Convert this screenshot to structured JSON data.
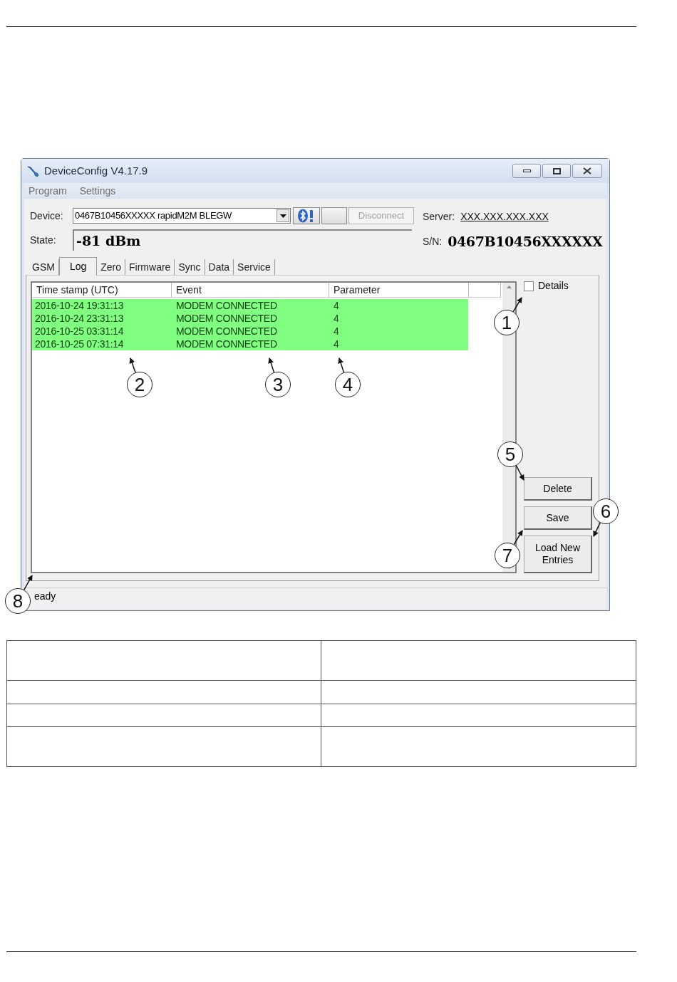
{
  "window": {
    "title": "DeviceConfig V4.17.9"
  },
  "menu": [
    {
      "label": "Program"
    },
    {
      "label": "Settings"
    }
  ],
  "device": {
    "label": "Device:",
    "value": "0467B10456XXXXX rapidM2M BLEGW"
  },
  "connect_buttons": [
    {
      "kind": "bluetooth"
    },
    {
      "kind": "blank"
    },
    {
      "kind": "text",
      "label": "Disconnect",
      "disabled": true
    }
  ],
  "server": {
    "label": "Server:",
    "value": "XXX.XXX.XXX.XXX"
  },
  "state": {
    "label": "State:",
    "value": "-81 dBm"
  },
  "serial": {
    "label": "S/N:",
    "value": "0467B10456XXXXXX"
  },
  "tabs": [
    {
      "label": "GSM",
      "selected": false
    },
    {
      "label": "Log",
      "selected": true
    },
    {
      "label": "Zero",
      "selected": false
    },
    {
      "label": "Firmware",
      "selected": false
    },
    {
      "label": "Sync",
      "selected": false
    },
    {
      "label": "Data",
      "selected": false
    },
    {
      "label": "Service",
      "selected": false
    }
  ],
  "table": {
    "columns": [
      "Time stamp (UTC)",
      "Event",
      "Parameter"
    ],
    "rows": [
      {
        "cells": [
          "2016-10-24 19:31:13",
          "MODEM CONNECTED",
          "4"
        ],
        "color": "#80ff80"
      },
      {
        "cells": [
          "2016-10-24 23:31:13",
          "MODEM CONNECTED",
          "4"
        ],
        "color": "#80ff80"
      },
      {
        "cells": [
          "2016-10-25 03:31:14",
          "MODEM CONNECTED",
          "4"
        ],
        "color": "#80ff80"
      },
      {
        "cells": [
          "2016-10-25 07:31:14",
          "MODEM CONNECTED",
          "4"
        ],
        "color": "#80ff80"
      }
    ]
  },
  "details": {
    "label": "Details",
    "checked": false
  },
  "buttons": [
    {
      "label": "Delete"
    },
    {
      "label": "Save"
    },
    {
      "label": "Load New Entries"
    }
  ],
  "status_bar": "eady",
  "callouts": [
    "1",
    "2",
    "3",
    "4",
    "5",
    "6",
    "7",
    "8"
  ]
}
